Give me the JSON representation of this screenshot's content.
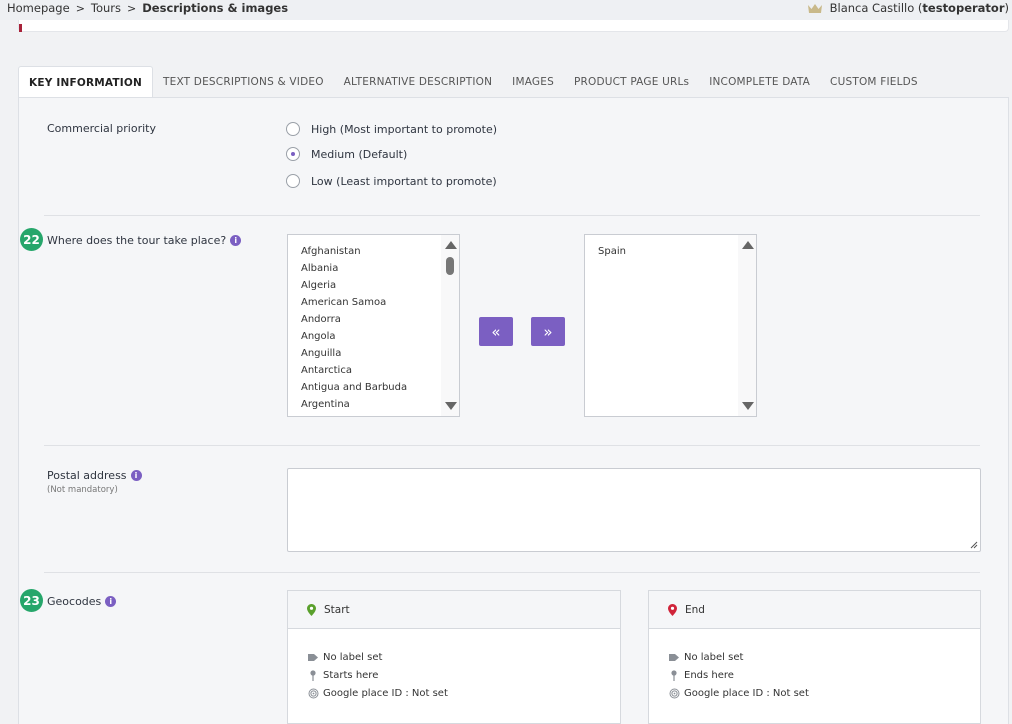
{
  "breadcrumb": {
    "items": [
      "Homepage",
      "Tours"
    ],
    "current": "Descriptions & images",
    "separator": ">"
  },
  "user": {
    "name": "Blanca Castillo",
    "role": "testoperator"
  },
  "tabs": [
    {
      "label": "KEY INFORMATION",
      "active": true
    },
    {
      "label": "TEXT DESCRIPTIONS & VIDEO"
    },
    {
      "label": "ALTERNATIVE DESCRIPTION"
    },
    {
      "label": "IMAGES"
    },
    {
      "label": "PRODUCT PAGE URLs"
    },
    {
      "label": "INCOMPLETE DATA"
    },
    {
      "label": "CUSTOM FIELDS"
    }
  ],
  "commercial_priority": {
    "label": "Commercial priority",
    "options": [
      {
        "label": "High (Most important to promote)",
        "selected": false
      },
      {
        "label": "Medium (Default)",
        "selected": true
      },
      {
        "label": "Low (Least important to promote)",
        "selected": false
      }
    ]
  },
  "location": {
    "step": "22",
    "label": "Where does the tour take place?",
    "available": [
      "Afghanistan",
      "Albania",
      "Algeria",
      "American Samoa",
      "Andorra",
      "Angola",
      "Anguilla",
      "Antarctica",
      "Antigua and Barbuda",
      "Argentina"
    ],
    "selected": [
      "Spain"
    ],
    "move_left": "«",
    "move_right": "»"
  },
  "postal": {
    "label": "Postal address",
    "sublabel": "(Not mandatory)",
    "value": ""
  },
  "geocodes": {
    "step": "23",
    "label": "Geocodes",
    "start": {
      "title": "Start",
      "label_text": "No label set",
      "place_text": "Starts here",
      "google_text": "Google place ID : Not set"
    },
    "end": {
      "title": "End",
      "label_text": "No label set",
      "place_text": "Ends here",
      "google_text": "Google place ID : Not set"
    }
  },
  "colors": {
    "accent": "#7b5fc2",
    "badge": "#26a66b",
    "start_pin": "#5aa02c",
    "end_pin": "#d0243a"
  }
}
